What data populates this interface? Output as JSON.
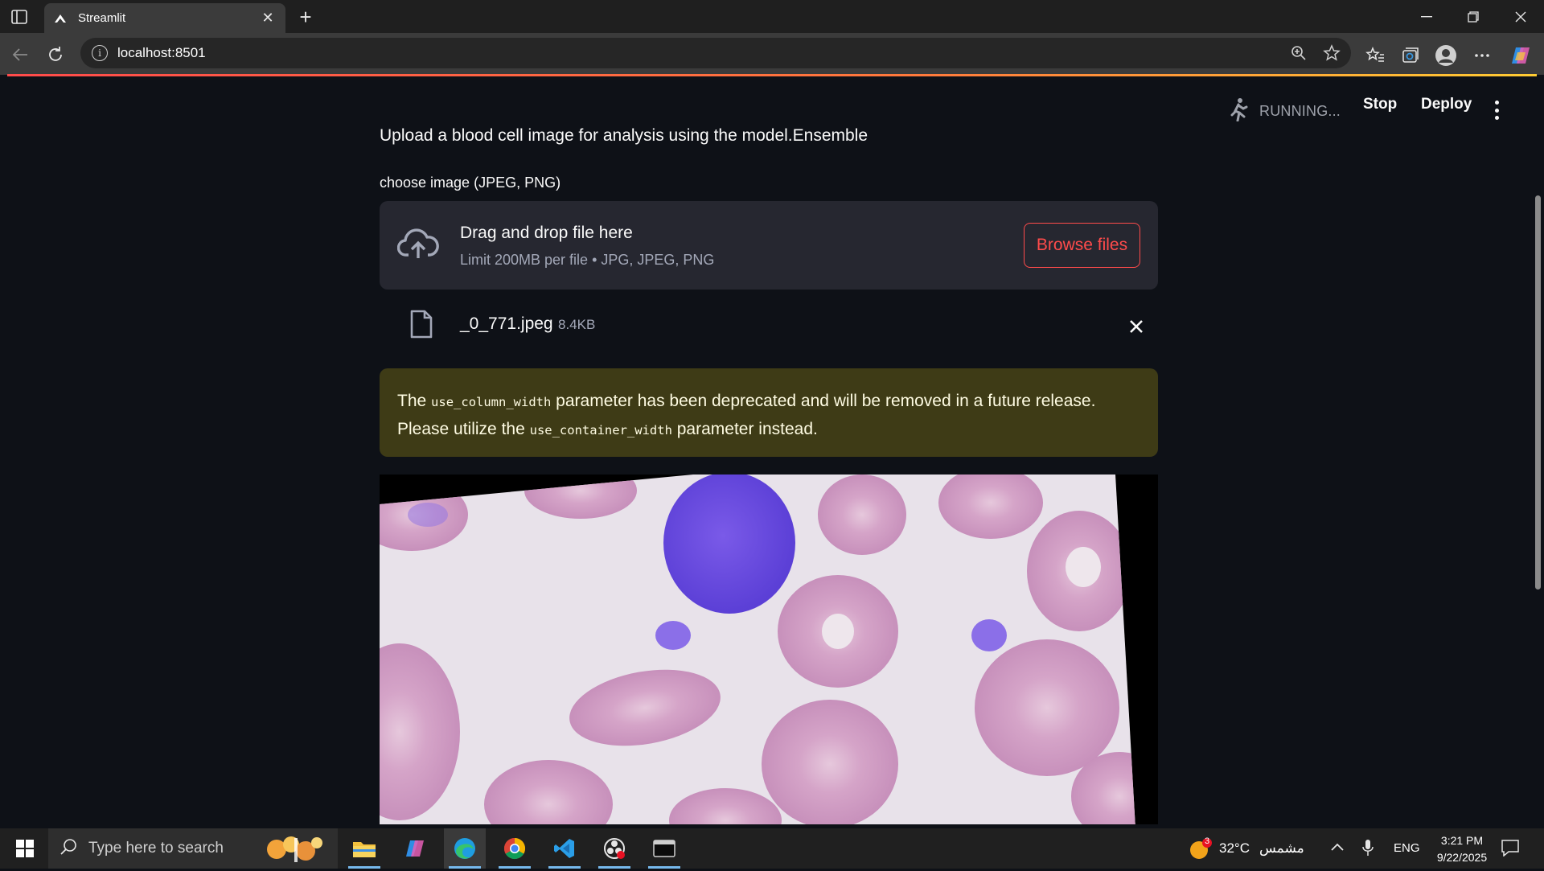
{
  "browser": {
    "tab_title": "Streamlit",
    "url": "localhost:8501"
  },
  "header": {
    "status": "RUNNING...",
    "stop_label": "Stop",
    "deploy_label": "Deploy"
  },
  "main": {
    "intro_text": "Upload a blood cell image for analysis using the model.Ensemble",
    "uploader_label": "choose image (JPEG, PNG)",
    "dropzone_title": "Drag and drop file here",
    "dropzone_limit": "Limit 200MB per file • JPG, JPEG, PNG",
    "browse_label": "Browse files",
    "uploaded_file_name": "_0_771.jpeg",
    "uploaded_file_size": "8.4KB",
    "warning": {
      "part1": "The ",
      "code1": "use_column_width",
      "part2": " parameter has been deprecated and will be removed in a future release. Please utilize the ",
      "code2": "use_container_width",
      "part3": " parameter instead."
    }
  },
  "taskbar": {
    "search_placeholder": "Type here to search",
    "weather_temp": "32°C",
    "weather_desc": "مشمس",
    "weather_badge": "3",
    "language": "ENG",
    "time": "3:21 PM",
    "date": "9/22/2025"
  },
  "colors": {
    "accent": "#ff4b4b",
    "page_bg": "#0e1117",
    "dropzone_bg": "#262730",
    "warning_bg": "#3e3b16"
  }
}
